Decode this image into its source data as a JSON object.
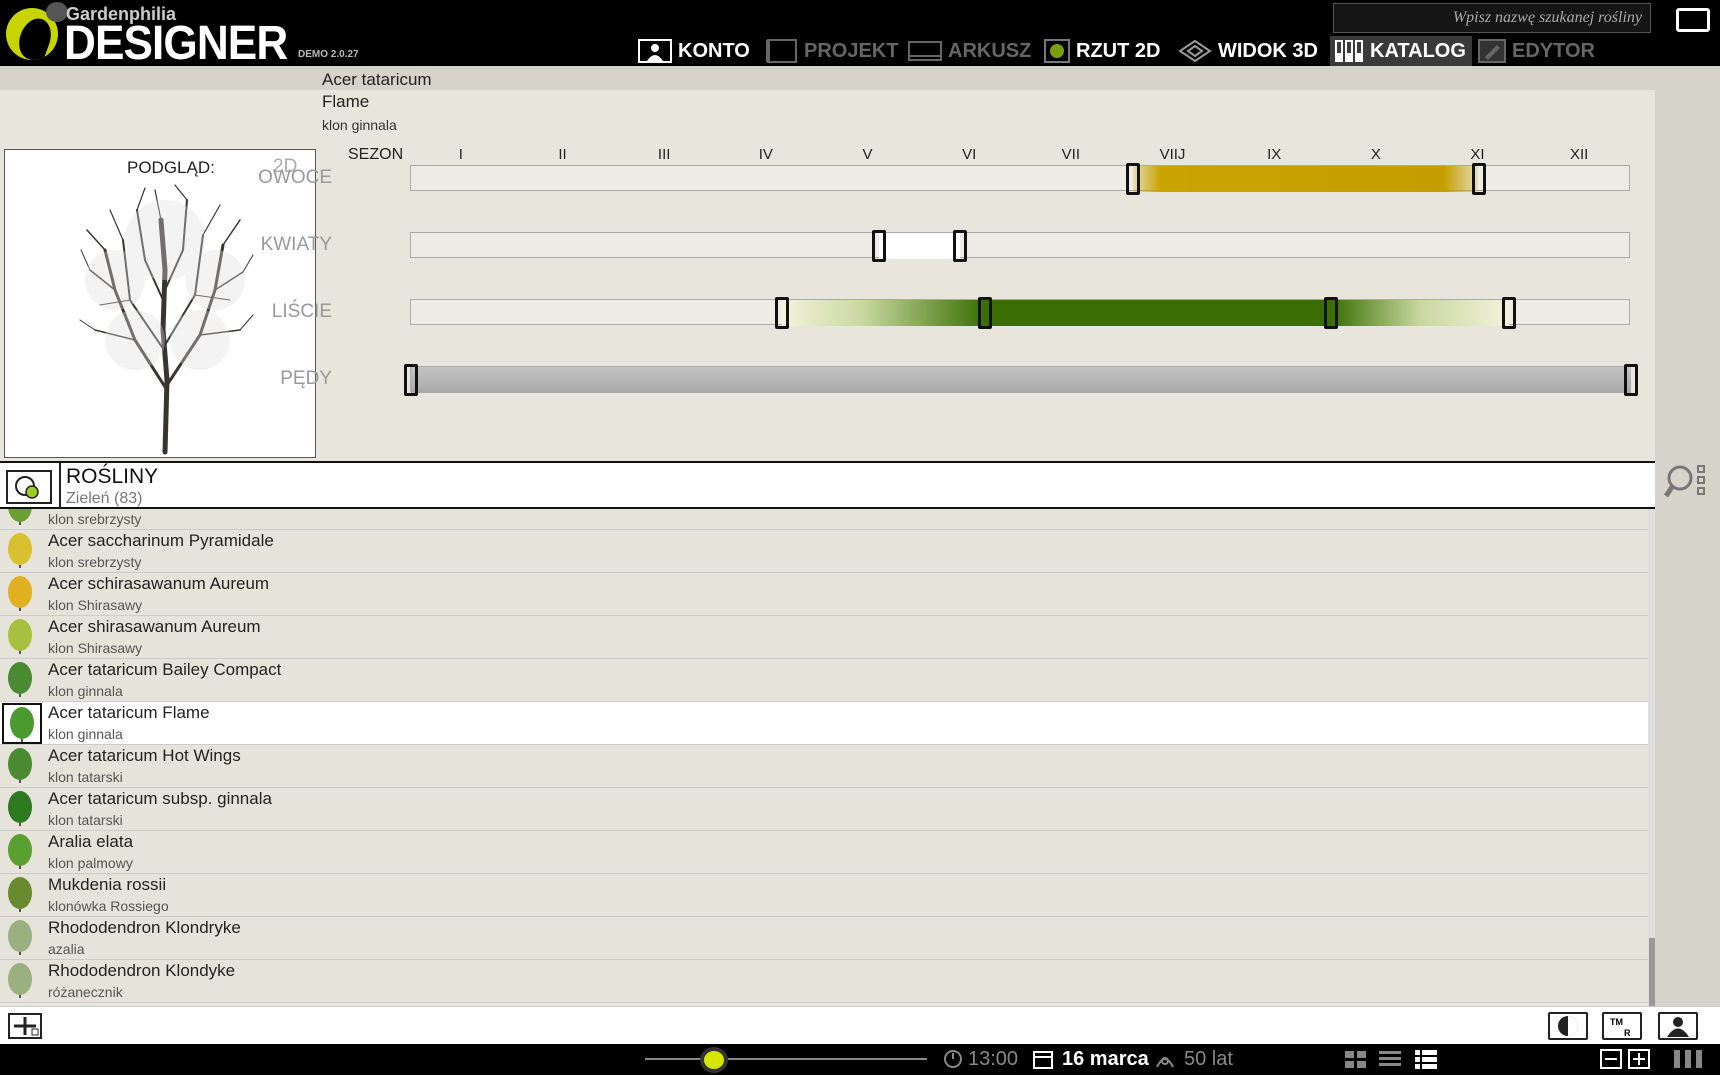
{
  "brand": {
    "name": "Gardenphilia",
    "product": "DESIGNER",
    "version": "DEMO 2.0.27"
  },
  "nav": [
    {
      "label": "KONTO",
      "icon": "account-icon",
      "state": "active"
    },
    {
      "label": "PROJEKT",
      "icon": "project-icon",
      "state": "dim"
    },
    {
      "label": "ARKUSZ",
      "icon": "sheet-icon",
      "state": "dim"
    },
    {
      "label": "RZUT 2D",
      "icon": "plan-2d-icon",
      "state": "active"
    },
    {
      "label": "WIDOK 3D",
      "icon": "view-3d-icon",
      "state": "active"
    },
    {
      "label": "KATALOG",
      "icon": "catalog-icon",
      "state": "selected"
    },
    {
      "label": "EDYTOR",
      "icon": "editor-icon",
      "state": "dim"
    }
  ],
  "search": {
    "placeholder": "Wpisz nazwę szukanej rośliny"
  },
  "plant": {
    "latin": "Acer tataricum",
    "cultivar": "Flame",
    "common": "klon ginnala"
  },
  "preview": {
    "label": "PODGLĄD:",
    "mode": "2D"
  },
  "season": {
    "label": "SEZON",
    "months": [
      "I",
      "II",
      "III",
      "IV",
      "V",
      "VI",
      "VII",
      "VIIJ",
      "IX",
      "X",
      "XI",
      "XII"
    ],
    "rows": [
      {
        "label": "OWOCE",
        "start": 7.1,
        "end": 10.5,
        "color": "#c9a400"
      },
      {
        "label": "KWIATY",
        "start": 4.6,
        "end": 5.4,
        "color": "#ffffff"
      },
      {
        "label": "LIŚCIE",
        "start": 3.65,
        "end": 10.8,
        "inner_start": 5.65,
        "inner_end": 9.05,
        "color": "#3a6e05"
      },
      {
        "label": "PĘDY",
        "start": 0.0,
        "end": 12.0,
        "color": "#a8a8a8"
      }
    ]
  },
  "list": {
    "title": "ROŚLINY",
    "subtitle": "Zieleń  (83)",
    "items": [
      {
        "name": "",
        "common": "klon srebrzysty",
        "color": "#6aa030"
      },
      {
        "name": "Acer saccharinum  Pyramidale",
        "common": "klon srebrzysty",
        "color": "#d8c030"
      },
      {
        "name": "Acer schirasawanum  Aureum",
        "common": "klon Shirasawy",
        "color": "#e0b020"
      },
      {
        "name": "Acer shirasawanum  Aureum",
        "common": "klon Shirasawy",
        "color": "#a8c040"
      },
      {
        "name": "Acer tataricum  Bailey Compact",
        "common": "klon ginnala",
        "color": "#4a8a30"
      },
      {
        "name": "Acer tataricum  Flame",
        "common": "klon ginnala",
        "color": "#4a9a30",
        "selected": true
      },
      {
        "name": "Acer tataricum  Hot Wings",
        "common": "klon tatarski",
        "color": "#4a8a30"
      },
      {
        "name": "Acer tataricum  subsp. ginnala",
        "common": "klon tatarski",
        "color": "#2e7a20"
      },
      {
        "name": "Aralia elata",
        "common": "klon palmowy",
        "color": "#5aa030"
      },
      {
        "name": "Mukdenia rossii",
        "common": "klonówka Rossiego",
        "color": "#6a8a30"
      },
      {
        "name": "Rhododendron  Klondryke",
        "common": "azalia",
        "color": "#9ab080"
      },
      {
        "name": "Rhododendron  Klondyke",
        "common": "różanecznik",
        "color": "#9ab080"
      }
    ]
  },
  "status": {
    "time": "13:00",
    "date": "16 marca",
    "age": "50 lat"
  }
}
